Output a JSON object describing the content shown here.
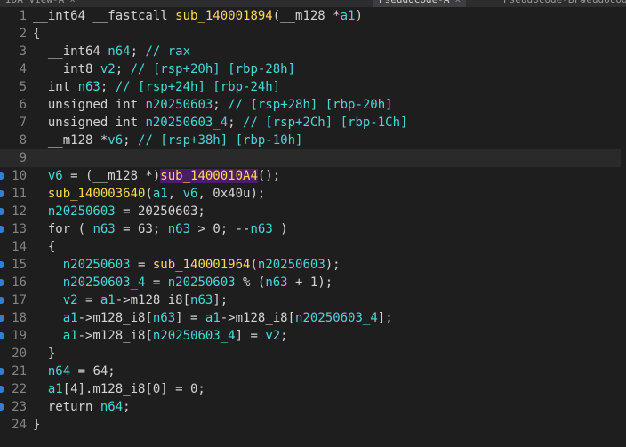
{
  "tabs": [
    {
      "label": "IDA View-A",
      "active": false
    },
    {
      "label": "Pseudocode-A",
      "active": true
    },
    {
      "label": "Pseudocode-B",
      "active": false
    },
    {
      "label": "Pseudocode-C",
      "active": false
    }
  ],
  "code": {
    "lines": [
      [
        {
          "t": "__int64 __fastcall ",
          "c": "ty"
        },
        {
          "t": "sub_140001894",
          "c": "f"
        },
        {
          "t": "(__m128 *",
          "c": "ty"
        },
        {
          "t": "a1",
          "c": "v"
        },
        {
          "t": ")",
          "c": "k"
        }
      ],
      [
        {
          "t": "{",
          "c": "k"
        }
      ],
      [
        {
          "t": "  __int64 ",
          "c": "ty"
        },
        {
          "t": "n64",
          "c": "v"
        },
        {
          "t": "; ",
          "c": "k"
        },
        {
          "t": "// rax",
          "c": "c"
        }
      ],
      [
        {
          "t": "  __int8 ",
          "c": "ty"
        },
        {
          "t": "v2",
          "c": "v"
        },
        {
          "t": "; ",
          "c": "k"
        },
        {
          "t": "// [rsp+20h] [rbp-28h]",
          "c": "c"
        }
      ],
      [
        {
          "t": "  int ",
          "c": "ty"
        },
        {
          "t": "n63",
          "c": "v"
        },
        {
          "t": "; ",
          "c": "k"
        },
        {
          "t": "// [rsp+24h] [rbp-24h]",
          "c": "c"
        }
      ],
      [
        {
          "t": "  unsigned int ",
          "c": "ty"
        },
        {
          "t": "n20250603",
          "c": "v"
        },
        {
          "t": "; ",
          "c": "k"
        },
        {
          "t": "// [rsp+28h] [rbp-20h]",
          "c": "c"
        }
      ],
      [
        {
          "t": "  unsigned int ",
          "c": "ty"
        },
        {
          "t": "n20250603_4",
          "c": "v"
        },
        {
          "t": "; ",
          "c": "k"
        },
        {
          "t": "// [rsp+2Ch] [rbp-1Ch]",
          "c": "c"
        }
      ],
      [
        {
          "t": "  __m128 *",
          "c": "ty"
        },
        {
          "t": "v6",
          "c": "v"
        },
        {
          "t": "; ",
          "c": "k"
        },
        {
          "t": "// [rsp+38h] [rbp-10h]",
          "c": "c"
        }
      ],
      [],
      [
        {
          "t": "  ",
          "c": "k"
        },
        {
          "t": "v6",
          "c": "v"
        },
        {
          "t": " = (__m128 *)",
          "c": "k"
        },
        {
          "t": "sub_1400010A4",
          "c": "hl"
        },
        {
          "t": "();",
          "c": "k"
        }
      ],
      [
        {
          "t": "  ",
          "c": "k"
        },
        {
          "t": "sub_140003640",
          "c": "f"
        },
        {
          "t": "(",
          "c": "k"
        },
        {
          "t": "a1",
          "c": "v"
        },
        {
          "t": ", ",
          "c": "k"
        },
        {
          "t": "v6",
          "c": "v"
        },
        {
          "t": ", 0x40u);",
          "c": "k"
        }
      ],
      [
        {
          "t": "  ",
          "c": "k"
        },
        {
          "t": "n20250603",
          "c": "v"
        },
        {
          "t": " = 20250603;",
          "c": "k"
        }
      ],
      [
        {
          "t": "  for ( ",
          "c": "kw"
        },
        {
          "t": "n63",
          "c": "v"
        },
        {
          "t": " = 63; ",
          "c": "k"
        },
        {
          "t": "n63",
          "c": "v"
        },
        {
          "t": " > 0; --",
          "c": "k"
        },
        {
          "t": "n63",
          "c": "v"
        },
        {
          "t": " )",
          "c": "k"
        }
      ],
      [
        {
          "t": "  {",
          "c": "k"
        }
      ],
      [
        {
          "t": "    ",
          "c": "k"
        },
        {
          "t": "n20250603",
          "c": "v"
        },
        {
          "t": " = ",
          "c": "k"
        },
        {
          "t": "sub_140001964",
          "c": "f"
        },
        {
          "t": "(",
          "c": "k"
        },
        {
          "t": "n20250603",
          "c": "v"
        },
        {
          "t": ");",
          "c": "k"
        }
      ],
      [
        {
          "t": "    ",
          "c": "k"
        },
        {
          "t": "n20250603_4",
          "c": "v"
        },
        {
          "t": " = ",
          "c": "k"
        },
        {
          "t": "n20250603",
          "c": "v"
        },
        {
          "t": " % (",
          "c": "k"
        },
        {
          "t": "n63",
          "c": "v"
        },
        {
          "t": " + 1);",
          "c": "k"
        }
      ],
      [
        {
          "t": "    ",
          "c": "k"
        },
        {
          "t": "v2",
          "c": "v"
        },
        {
          "t": " = ",
          "c": "k"
        },
        {
          "t": "a1",
          "c": "v"
        },
        {
          "t": "->m128_i8[",
          "c": "k"
        },
        {
          "t": "n63",
          "c": "v"
        },
        {
          "t": "];",
          "c": "k"
        }
      ],
      [
        {
          "t": "    ",
          "c": "k"
        },
        {
          "t": "a1",
          "c": "v"
        },
        {
          "t": "->m128_i8[",
          "c": "k"
        },
        {
          "t": "n63",
          "c": "v"
        },
        {
          "t": "] = ",
          "c": "k"
        },
        {
          "t": "a1",
          "c": "v"
        },
        {
          "t": "->m128_i8[",
          "c": "k"
        },
        {
          "t": "n20250603_4",
          "c": "v"
        },
        {
          "t": "];",
          "c": "k"
        }
      ],
      [
        {
          "t": "    ",
          "c": "k"
        },
        {
          "t": "a1",
          "c": "v"
        },
        {
          "t": "->m128_i8[",
          "c": "k"
        },
        {
          "t": "n20250603_4",
          "c": "v"
        },
        {
          "t": "] = ",
          "c": "k"
        },
        {
          "t": "v2",
          "c": "v"
        },
        {
          "t": ";",
          "c": "k"
        }
      ],
      [
        {
          "t": "  }",
          "c": "k"
        }
      ],
      [
        {
          "t": "  ",
          "c": "k"
        },
        {
          "t": "n64",
          "c": "v"
        },
        {
          "t": " = 64;",
          "c": "k"
        }
      ],
      [
        {
          "t": "  ",
          "c": "k"
        },
        {
          "t": "a1",
          "c": "v"
        },
        {
          "t": "[4].m128_i8[0] = 0;",
          "c": "k"
        }
      ],
      [
        {
          "t": "  return ",
          "c": "kw"
        },
        {
          "t": "n64",
          "c": "v"
        },
        {
          "t": ";",
          "c": "k"
        }
      ],
      [
        {
          "t": "}",
          "c": "k"
        }
      ]
    ],
    "line_numbers": [
      "1",
      "2",
      "3",
      "4",
      "5",
      "6",
      "7",
      "8",
      "9",
      "10",
      "11",
      "12",
      "13",
      "14",
      "15",
      "16",
      "17",
      "18",
      "19",
      "20",
      "21",
      "22",
      "23",
      "24"
    ],
    "breakpoint_lines": [
      10,
      11,
      12,
      13,
      15,
      16,
      17,
      18,
      19,
      21,
      22,
      23
    ],
    "current_line": 9
  },
  "colors": {
    "background": "#1e1e1e",
    "line_number": "#858585",
    "function": "#ffd85a",
    "variable": "#4dd6d6",
    "highlight": "#4b1d66"
  }
}
